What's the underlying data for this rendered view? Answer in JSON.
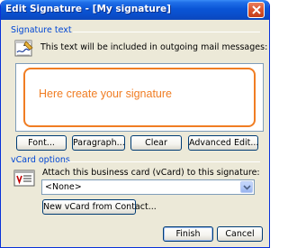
{
  "window": {
    "title": "Edit Signature - [My signature]"
  },
  "signature_group": {
    "title": "Signature text",
    "instruction": "This text will be included in outgoing mail messages:",
    "content": "Here create your signature",
    "accent_color": "#f07d23"
  },
  "format_buttons": {
    "font": "Font...",
    "paragraph": "Paragraph...",
    "clear": "Clear",
    "advanced_edit": "Advanced Edit..."
  },
  "vcard_group": {
    "title": "vCard options",
    "attach_label": "Attach this business card (vCard) to this signature:",
    "selected_option": "<None>",
    "new_from_contact": "New vCard from Contact..."
  },
  "dialog_buttons": {
    "finish": "Finish",
    "cancel": "Cancel"
  }
}
